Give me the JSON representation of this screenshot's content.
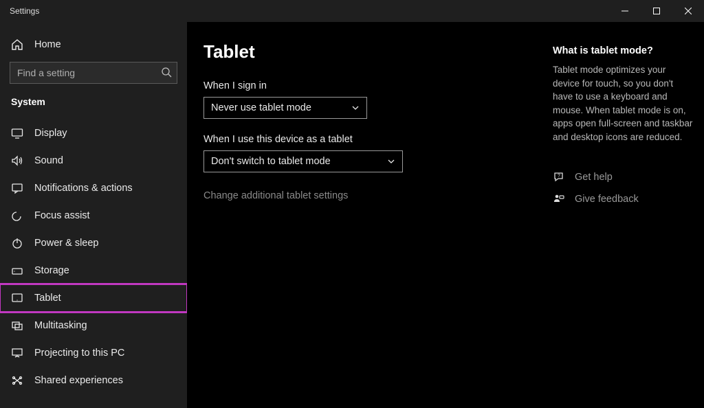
{
  "titlebar": {
    "title": "Settings"
  },
  "sidebar": {
    "home_label": "Home",
    "search_placeholder": "Find a setting",
    "category": "System",
    "items": [
      {
        "label": "Display"
      },
      {
        "label": "Sound"
      },
      {
        "label": "Notifications & actions"
      },
      {
        "label": "Focus assist"
      },
      {
        "label": "Power & sleep"
      },
      {
        "label": "Storage"
      },
      {
        "label": "Tablet"
      },
      {
        "label": "Multitasking"
      },
      {
        "label": "Projecting to this PC"
      },
      {
        "label": "Shared experiences"
      }
    ]
  },
  "main": {
    "title": "Tablet",
    "setting1": {
      "label": "When I sign in",
      "value": "Never use tablet mode"
    },
    "setting2": {
      "label": "When I use this device as a tablet",
      "value": "Don't switch to tablet mode"
    },
    "link": "Change additional tablet settings"
  },
  "aside": {
    "title": "What is tablet mode?",
    "body": "Tablet mode optimizes your device for touch, so you don't have to use a keyboard and mouse. When tablet mode is on, apps open full-screen and taskbar and desktop icons are reduced.",
    "help_label": "Get help",
    "feedback_label": "Give feedback"
  }
}
